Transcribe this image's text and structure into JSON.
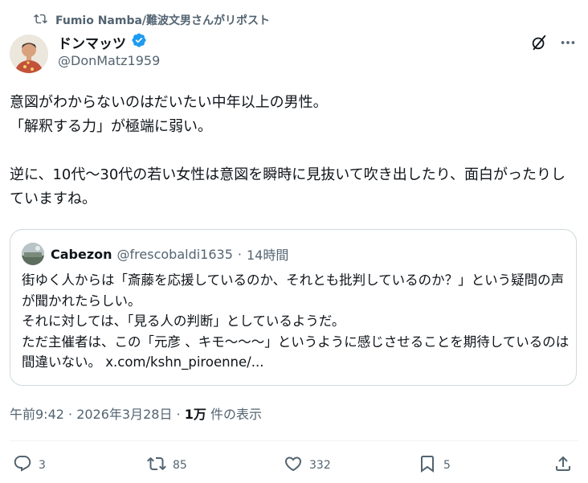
{
  "repost": {
    "icon": "repost-icon",
    "text": "Fumio Namba/難波文男さんがリポスト"
  },
  "author": {
    "display_name": "ドンマッツ",
    "handle": "@DonMatz1959",
    "verified": true,
    "verified_color": "#1d9bf0"
  },
  "tweet": {
    "text": "意図がわからないのはだいたい中年以上の男性。\n「解釈する力」が極端に弱い。\n\n逆に、10代〜30代の若い女性は意図を瞬時に見抜いて吹き出したり、面白がったりしていますね。"
  },
  "quote": {
    "name": "Cabezon",
    "handle": "@frescobaldi1635",
    "separator": "·",
    "time": "14時間",
    "text": "街ゆく人からは「斎藤を応援しているのか、それとも批判しているのか？」という疑問の声が聞かれたらしい。\nそれに対しては、「見る人の判断」としているようだ。\nただ主催者は、この「元彦 、キモ〜〜〜」というように感じさせることを期待しているのは間違いない。 ",
    "link_text": "x.com/kshn_piroenne/..."
  },
  "meta": {
    "timestamp": "午前9:42 · 2026年3月28日 · ",
    "views_count": "1万",
    "views_label": " 件の表示"
  },
  "actions": {
    "reply_count": "3",
    "repost_count": "85",
    "like_count": "332",
    "bookmark_count": "5"
  },
  "colors": {
    "text_primary": "#0f1419",
    "text_secondary": "#536471",
    "border": "#cfd9de",
    "accent": "#1d9bf0"
  }
}
